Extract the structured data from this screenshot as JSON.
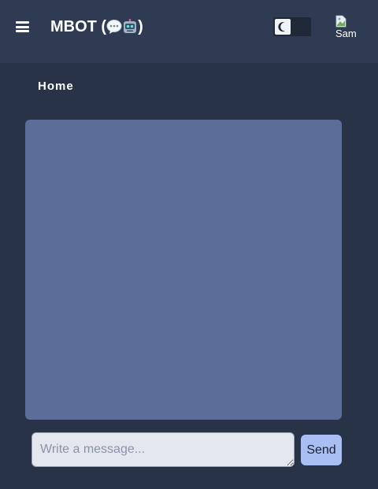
{
  "header": {
    "title": "MBOT (💬🤖)",
    "title_text": "MBOT (",
    "title_close": ")",
    "menu_icon": "hamburger-icon",
    "theme_toggle": {
      "icon": "moon-icon",
      "mode": "dark"
    },
    "avatar": {
      "alt": "Sam",
      "icon": "broken-image-icon"
    }
  },
  "breadcrumb": {
    "current": "Home"
  },
  "chat": {
    "messages": []
  },
  "composer": {
    "placeholder": "Write a message...",
    "value": "",
    "send_label": "Send"
  },
  "colors": {
    "page_bg": "#283347",
    "header_bg": "#2f3b52",
    "chat_bg": "#5b6d98",
    "send_bg": "#a9bff3",
    "input_bg": "#e5e7ee"
  }
}
